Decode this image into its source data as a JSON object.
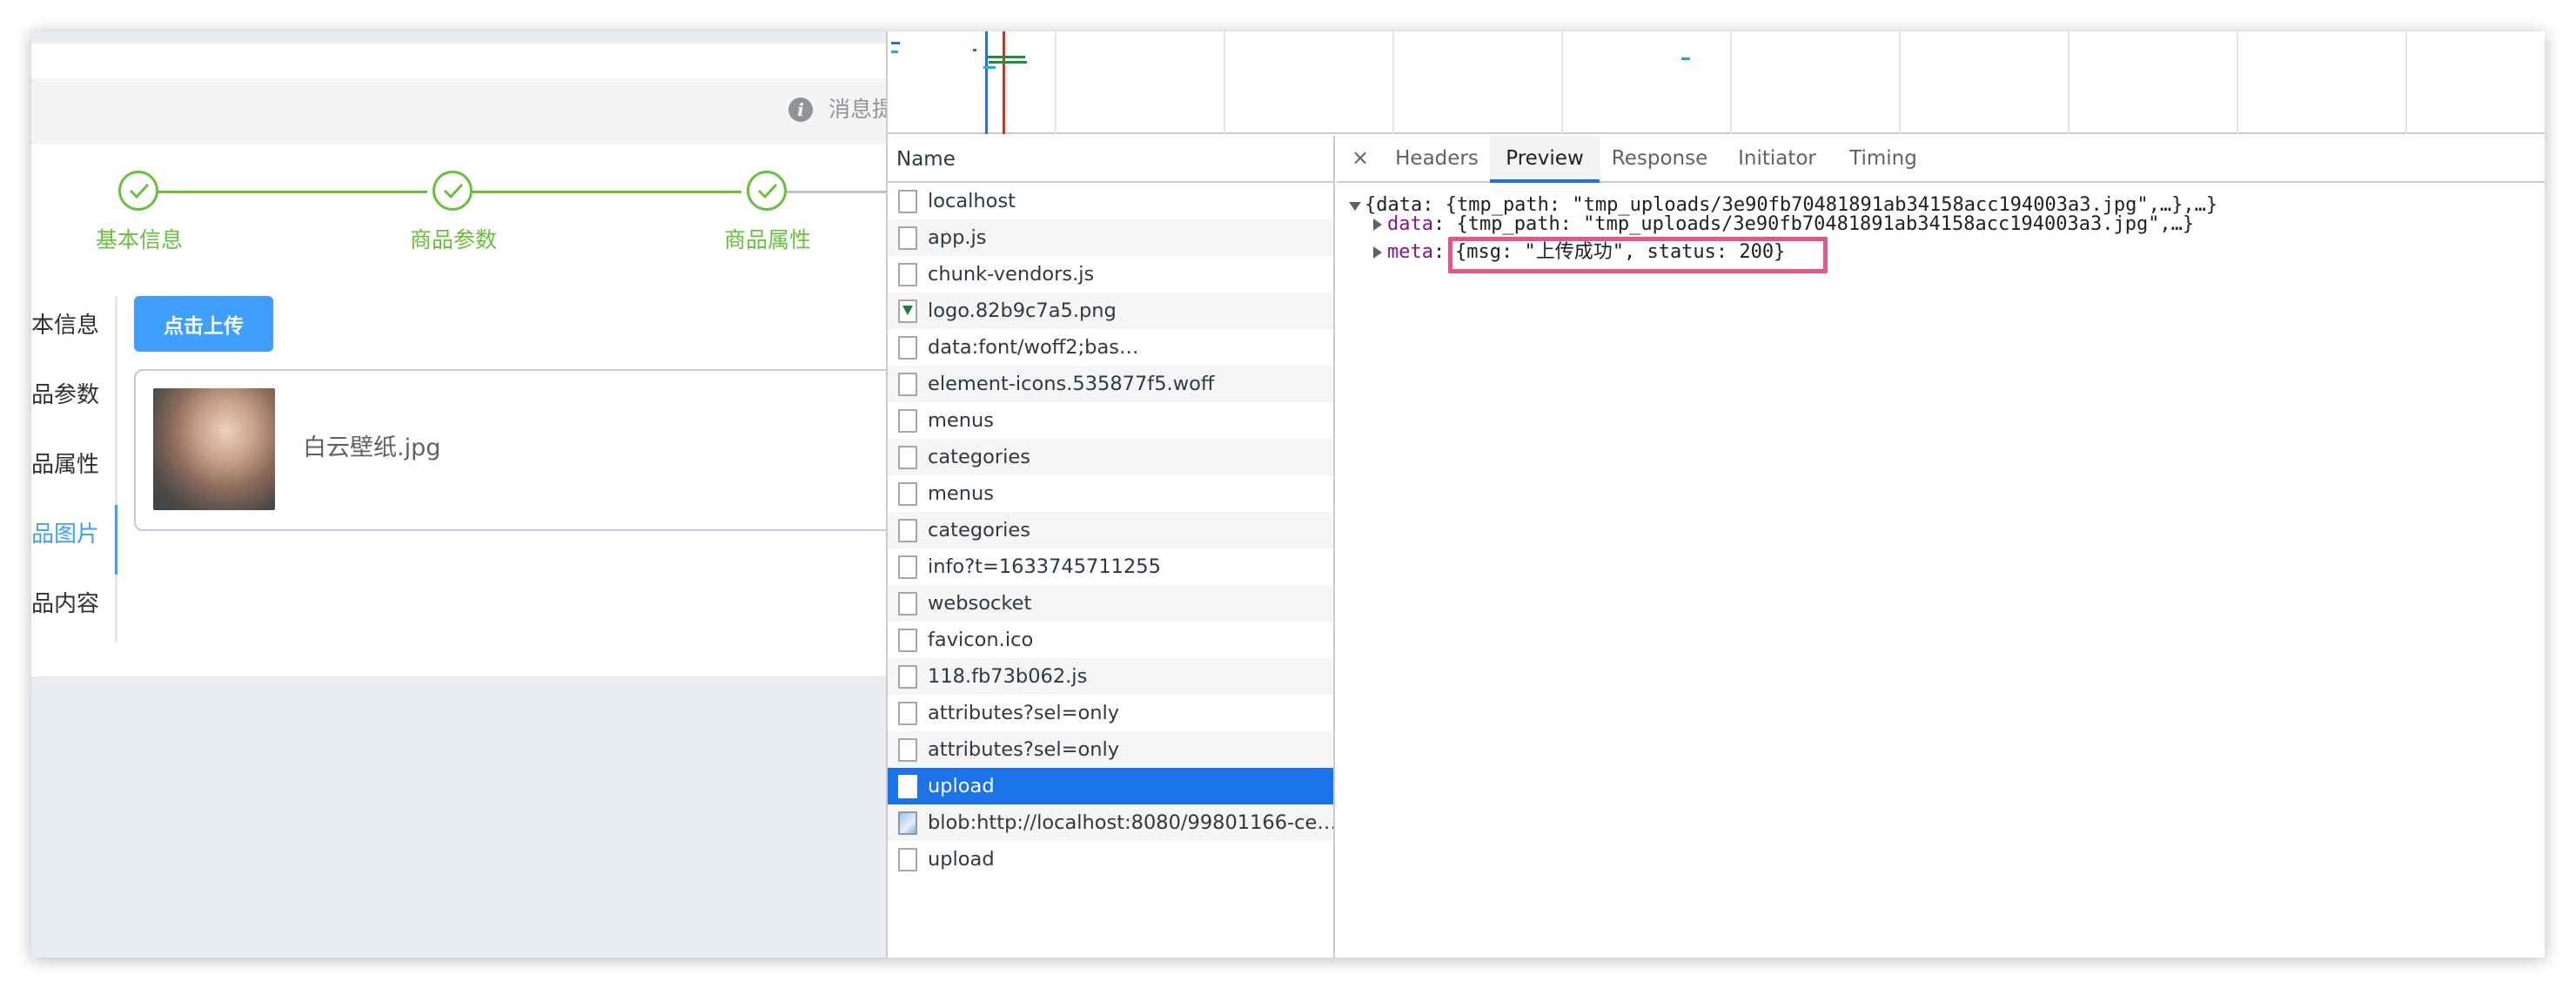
{
  "webpage": {
    "alert_text": "消息提",
    "steps": [
      {
        "label": "基本信息"
      },
      {
        "label": "商品参数"
      },
      {
        "label": "商品属性"
      }
    ],
    "vertical_tabs": [
      {
        "label": "本信息",
        "active": false
      },
      {
        "label": "品参数",
        "active": false
      },
      {
        "label": "品属性",
        "active": false
      },
      {
        "label": "品图片",
        "active": true
      },
      {
        "label": "品内容",
        "active": false
      }
    ],
    "upload_button": "点击上传",
    "file_name": "白云壁纸.jpg",
    "colors": {
      "success": "#67c23a",
      "primary": "#409eff"
    }
  },
  "devtools": {
    "name_header": "Name",
    "requests": [
      {
        "name": "localhost",
        "icon": "file-icon",
        "selected": false
      },
      {
        "name": "app.js",
        "icon": "file-icon",
        "selected": false
      },
      {
        "name": "chunk-vendors.js",
        "icon": "file-icon",
        "selected": false
      },
      {
        "name": "logo.82b9c7a5.png",
        "icon": "image-file-icon",
        "selected": false
      },
      {
        "name": "data:font/woff2;bas…",
        "icon": "file-icon",
        "selected": false
      },
      {
        "name": "element-icons.535877f5.woff",
        "icon": "file-icon",
        "selected": false
      },
      {
        "name": "menus",
        "icon": "file-icon",
        "selected": false
      },
      {
        "name": "categories",
        "icon": "file-icon",
        "selected": false
      },
      {
        "name": "menus",
        "icon": "file-icon",
        "selected": false
      },
      {
        "name": "categories",
        "icon": "file-icon",
        "selected": false
      },
      {
        "name": "info?t=1633745711255",
        "icon": "file-icon",
        "selected": false
      },
      {
        "name": "websocket",
        "icon": "file-icon",
        "selected": false
      },
      {
        "name": "favicon.ico",
        "icon": "file-icon",
        "selected": false
      },
      {
        "name": "118.fb73b062.js",
        "icon": "file-icon",
        "selected": false
      },
      {
        "name": "attributes?sel=only",
        "icon": "file-icon",
        "selected": false
      },
      {
        "name": "attributes?sel=only",
        "icon": "file-icon",
        "selected": false
      },
      {
        "name": "upload",
        "icon": "file-icon",
        "selected": true
      },
      {
        "name": "blob:http://localhost:8080/99801166-ce…",
        "icon": "blob-image-icon",
        "selected": false
      },
      {
        "name": "upload",
        "icon": "file-icon",
        "selected": false
      }
    ],
    "close_label": "×",
    "tabs": [
      {
        "label": "Headers",
        "active": false
      },
      {
        "label": "Preview",
        "active": true
      },
      {
        "label": "Response",
        "active": false
      },
      {
        "label": "Initiator",
        "active": false
      },
      {
        "label": "Timing",
        "active": false
      }
    ],
    "preview": {
      "root_line": "{data: {tmp_path: \"tmp_uploads/3e90fb70481891ab34158acc194003a3.jpg\",…},…}",
      "data_key": "data",
      "data_value": " {tmp_path: \"tmp_uploads/3e90fb70481891ab34158acc194003a3.jpg\",…}",
      "meta_key": "meta",
      "meta_value": "{msg: \"上传成功\", status: 200}"
    },
    "colors": {
      "selected_row": "#1a73e8",
      "highlight": "#e5548b",
      "key": "#881391"
    }
  }
}
